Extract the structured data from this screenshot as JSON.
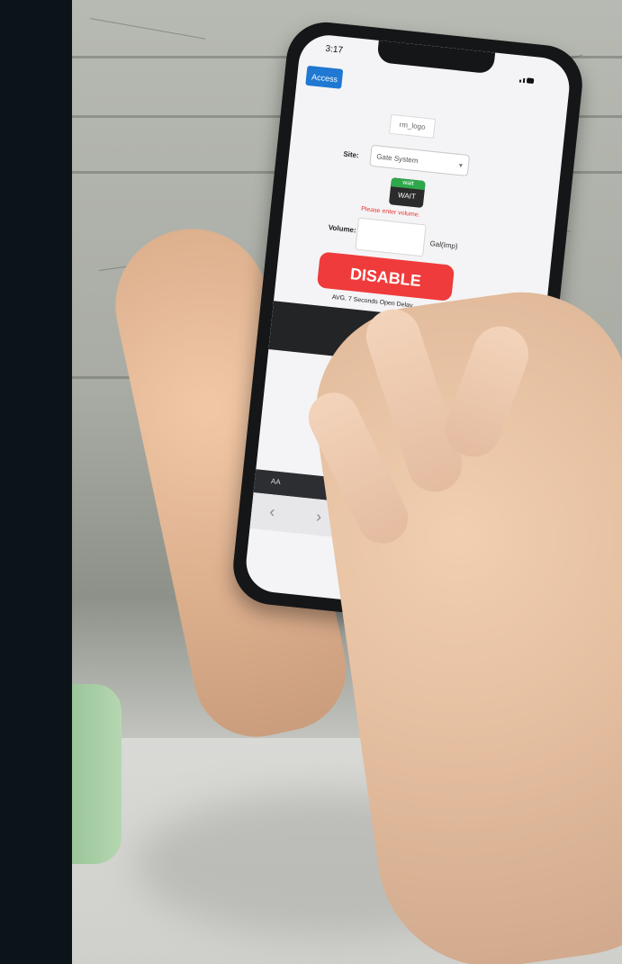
{
  "phone": {
    "status_time": "3:17",
    "access_button": "Access",
    "logo_text": "rm_logo",
    "site_label": "Site:",
    "site_value": "Gate System",
    "wait_badge_top": "wait",
    "wait_badge_bottom": "WAIT",
    "warning_text": "Please enter volume.",
    "volume_label": "Volume:",
    "volume_value": "",
    "volume_unit": "Gal(Imp)",
    "disable_button": "DISABLE",
    "delay_text": "AVG. 7 Seconds Open Delay",
    "logout_button": "LOG OUT",
    "toolbar_aa": "AA"
  },
  "colors": {
    "access_blue": "#1f78d1",
    "disable_red": "#ef3b3b",
    "logout_dark": "#232426",
    "warning_red": "#e53535",
    "wait_green": "#2ea84a"
  }
}
